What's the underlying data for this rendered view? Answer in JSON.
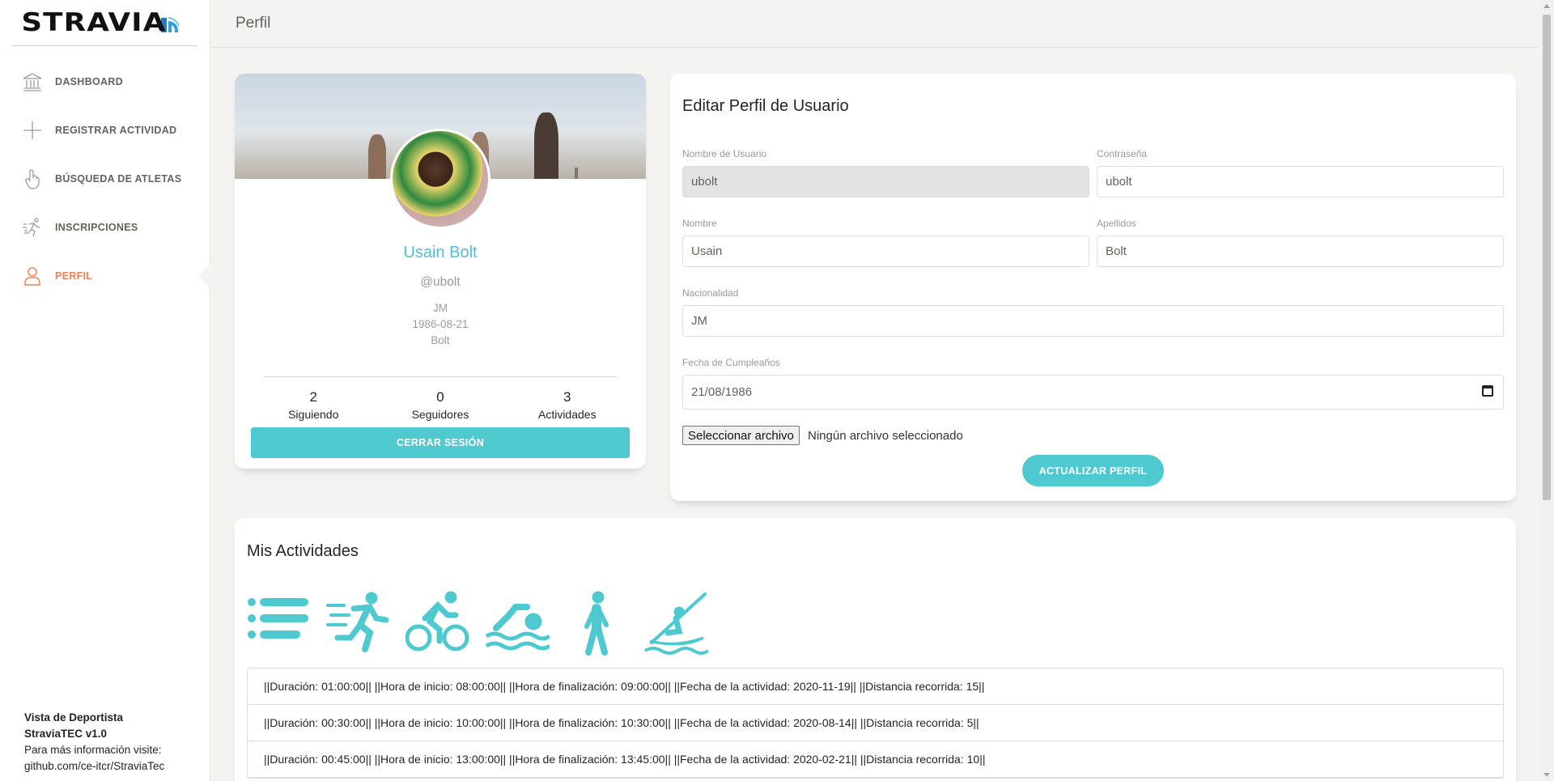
{
  "brand": {
    "logo_text": "STRAVIA"
  },
  "sidebar": {
    "items": [
      {
        "label": "DASHBOARD",
        "icon": "bank-icon"
      },
      {
        "label": "REGISTRAR ACTIVIDAD",
        "icon": "plus-icon"
      },
      {
        "label": "BÚSQUEDA DE ATLETAS",
        "icon": "pointer-hand-icon"
      },
      {
        "label": "INSCRIPCIONES",
        "icon": "runner-icon"
      },
      {
        "label": "PERFIL",
        "icon": "user-icon",
        "active": true
      }
    ],
    "footer": {
      "line1": "Vista de Deportista",
      "line2": "StraviaTEC v1.0",
      "line3": "Para más información visite:",
      "line4": "github.com/ce-itcr/StraviaTec"
    }
  },
  "header": {
    "title": "Perfil"
  },
  "profile": {
    "name": "Usain Bolt",
    "username": "@ubolt",
    "nationality": "JM",
    "birthdate": "1986-08-21",
    "lastname": "Bolt",
    "stats": [
      {
        "value": "2",
        "label": "Siguiendo"
      },
      {
        "value": "0",
        "label": "Seguidores"
      },
      {
        "value": "3",
        "label": "Actividades"
      }
    ],
    "logout_label": "CERRAR SESIÓN"
  },
  "edit_form": {
    "title": "Editar Perfil de Usuario",
    "username_label": "Nombre de Usuario",
    "username_value": "ubolt",
    "password_label": "Contraseña",
    "password_value": "ubolt",
    "firstname_label": "Nombre",
    "firstname_value": "Usain",
    "lastname_label": "Apellidos",
    "lastname_value": "Bolt",
    "nationality_label": "Nacionalidad",
    "nationality_value": "JM",
    "birthday_label": "Fecha de Cumpleaños",
    "birthday_value": "21/08/1986",
    "file_button_label": "Seleccionar archivo",
    "file_status": "Ningún archivo seleccionado",
    "update_label": "ACTUALIZAR PERFIL"
  },
  "activities": {
    "title": "Mis Actividades",
    "filter_icons": [
      "list-icon",
      "running-icon",
      "cycling-icon",
      "swimming-icon",
      "walking-icon",
      "kayak-icon"
    ],
    "accent_color": "#4ec9cf",
    "rows": [
      "||Duración: 01:00:00|| ||Hora de inicio: 08:00:00|| ||Hora de finalización: 09:00:00|| ||Fecha de la actividad: 2020-11-19|| ||Distancia recorrida: 15||",
      "||Duración: 00:30:00|| ||Hora de inicio: 10:00:00|| ||Hora de finalización: 10:30:00|| ||Fecha de la actividad: 2020-08-14|| ||Distancia recorrida: 5||",
      "||Duración: 00:45:00|| ||Hora de inicio: 13:00:00|| ||Hora de finalización: 13:45:00|| ||Fecha de la actividad: 2020-02-21|| ||Distancia recorrida: 10||"
    ]
  }
}
